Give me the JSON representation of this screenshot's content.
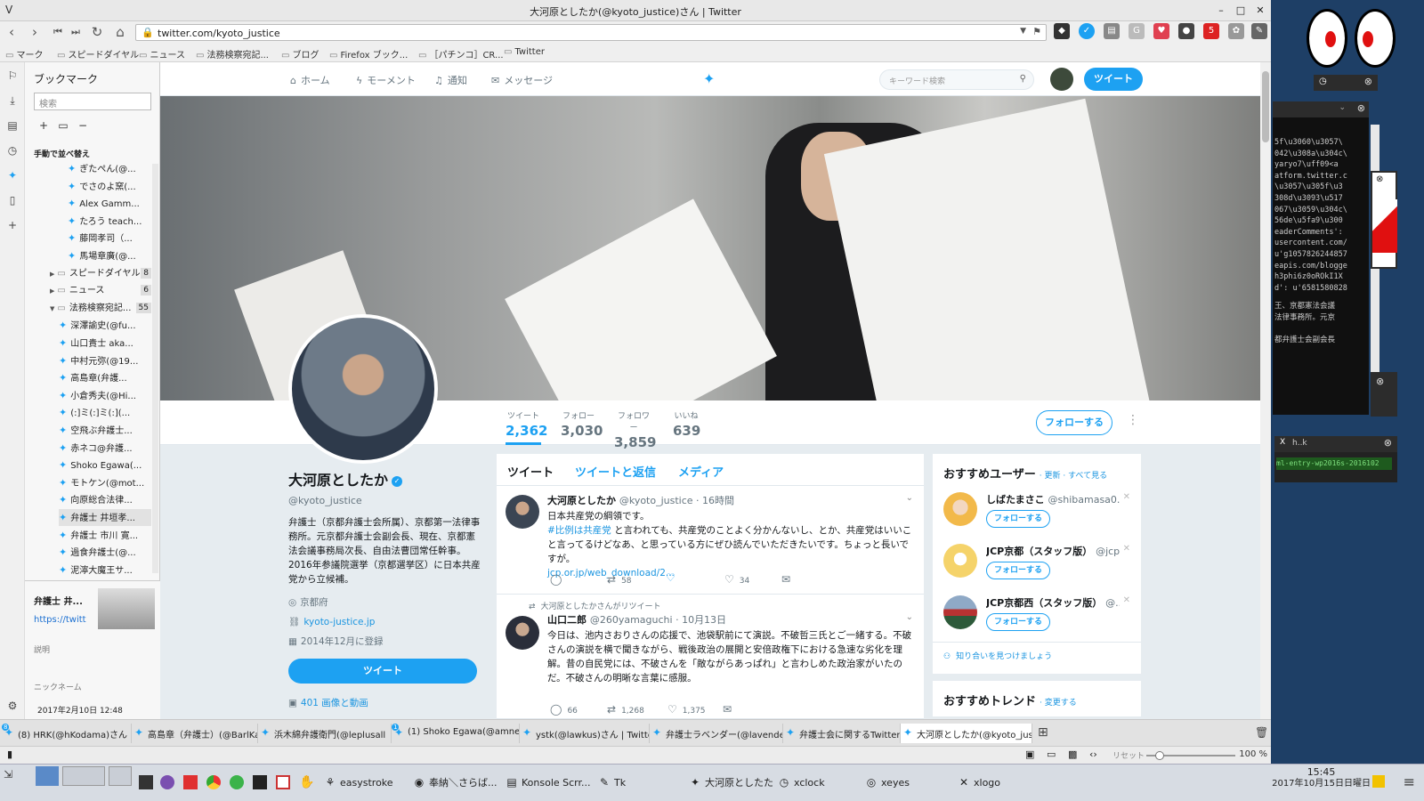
{
  "window": {
    "title": "大河原としたか(@kyoto_justice)さん | Twitter"
  },
  "nav": {
    "url": "twitter.com/kyoto_justice"
  },
  "bookmarks_bar": [
    "マーク",
    "スピードダイヤル",
    "ニュース",
    "法務検察宛記...",
    "ブログ",
    "Firefox ブック...",
    "［パチンコ］CR...",
    "Twitter"
  ],
  "sidebar": {
    "title": "ブックマーク",
    "search_placeholder": "検索",
    "sort_label": "手動で並べ替え",
    "tree": [
      {
        "label": "ぎたぺん(@...",
        "type": "tw",
        "indent": 2
      },
      {
        "label": "でさのよ窯(...",
        "type": "tw",
        "indent": 2
      },
      {
        "label": "Alex Gamm...",
        "type": "tw",
        "indent": 2
      },
      {
        "label": "たろう teach...",
        "type": "tw",
        "indent": 2
      },
      {
        "label": "藤岡孝司（...",
        "type": "tw",
        "indent": 2
      },
      {
        "label": "馬場章廣(@...",
        "type": "tw",
        "indent": 2
      },
      {
        "label": "スピードダイヤル",
        "type": "folder",
        "indent": 1,
        "count": "8",
        "arrow": "▶"
      },
      {
        "label": "ニュース",
        "type": "folder",
        "indent": 1,
        "count": "6",
        "arrow": "▶"
      },
      {
        "label": "法務検察宛記...",
        "type": "folder",
        "indent": 1,
        "count": "55",
        "arrow": "▼"
      },
      {
        "label": "深澤諭史(@fu...",
        "type": "tw",
        "indent": 1.5
      },
      {
        "label": "山口貴士 aka...",
        "type": "tw",
        "indent": 1.5
      },
      {
        "label": "中村元弥(@19...",
        "type": "tw",
        "indent": 1.5
      },
      {
        "label": "高島章(弁護...",
        "type": "tw",
        "indent": 1.5
      },
      {
        "label": "小倉秀夫(@Hi...",
        "type": "tw",
        "indent": 1.5
      },
      {
        "label": "(:]ミ(:]ミ(:](...",
        "type": "tw",
        "indent": 1.5
      },
      {
        "label": "空飛ぶ弁護士...",
        "type": "tw",
        "indent": 1.5
      },
      {
        "label": "赤ネコ@弁護...",
        "type": "tw",
        "indent": 1.5
      },
      {
        "label": "Shoko Egawa(...",
        "type": "tw",
        "indent": 1.5
      },
      {
        "label": "モトケン(@mot...",
        "type": "tw",
        "indent": 1.5
      },
      {
        "label": "向原総合法律...",
        "type": "tw",
        "indent": 1.5
      },
      {
        "label": "弁護士 井垣孝...",
        "type": "tw",
        "indent": 1.5
      },
      {
        "label": "弁護士 市川 寛...",
        "type": "tw",
        "indent": 1.5
      },
      {
        "label": "過食弁護士(@...",
        "type": "tw",
        "indent": 1.5
      },
      {
        "label": "泥濘大魔王サ...",
        "type": "tw",
        "indent": 1.5
      }
    ],
    "detail_title": "弁護士 井...",
    "detail_url": "https://twitt",
    "detail_desc_label": "説明",
    "detail_nick_label": "ニックネーム",
    "detail_date": "2017年2月10日 12:48"
  },
  "twitter_nav": {
    "home": "ホーム",
    "moments": "モーメント",
    "notifications": "通知",
    "messages": "メッセージ",
    "search_placeholder": "キーワード検索",
    "tweet_button": "ツイート"
  },
  "profile": {
    "name": "大河原としたか",
    "handle": "@kyoto_justice",
    "bio": "弁護士（京都弁護士会所属）、京都第一法律事務所。元京都弁護士会副会長、現在、京都憲法会議事務局次長、自由法曹団常任幹事。2016年参議院選挙（京都選挙区）に日本共産党から立候補。",
    "location": "京都府",
    "website": "kyoto-justice.jp",
    "joined": "2014年12月に登録",
    "tweet_button": "ツイート",
    "media_link": "401 画像と動画",
    "follow_button": "フォローする",
    "stats": [
      {
        "label": "ツイート",
        "value": "2,362"
      },
      {
        "label": "フォロー",
        "value": "3,030"
      },
      {
        "label": "フォロワー",
        "value": "3,859"
      },
      {
        "label": "いいね",
        "value": "639"
      }
    ]
  },
  "timeline": {
    "tabs": [
      "ツイート",
      "ツイートと返信",
      "メディア"
    ],
    "tweets": [
      {
        "name": "大河原としたか",
        "meta": "@kyoto_justice · 16時間",
        "line1": "日本共産党の綱領です。",
        "hashtag": "#比例は共産党",
        "line2": " と言われても、共産党のことよく分かんないし、とか、共産党はいいこと言ってるけどなあ、と思っている方にぜひ読んでいただきたいです。ちょっと長いですが。",
        "link": "jcp.or.jp/web_download/2...",
        "retweets": "58",
        "likes": "34"
      },
      {
        "rt_note": "大河原としたかさんがリツイート",
        "name": "山口二郎",
        "meta": "@260yamaguchi · 10月13日",
        "text": "今日は、池内さおりさんの応援で、池袋駅前にて演説。不破哲三氏とご一緒する。不破さんの演説を横で聞きながら、戦後政治の展開と安倍政権下における急速な劣化を理解。昔の自民党には、不破さんを「敵ながらあっぱれ」と言わしめた政治家がいたのだ。不破さんの明晰な言葉に感服。",
        "replies": "66",
        "retweets": "1,268",
        "likes": "1,375"
      }
    ]
  },
  "who_to_follow": {
    "title": "おすすめユーザー",
    "links": "· 更新 · すべて見る",
    "users": [
      {
        "name": "しばたまさこ",
        "handle": "@shibamasa0...",
        "color": "#f2b94a"
      },
      {
        "name": "JCP京都（スタッフ版）",
        "handle": "@jcp...",
        "color": "#f5d36a"
      },
      {
        "name": "JCP京都西（スタッフ版）",
        "handle": "@...",
        "color": "#2d5a3a"
      }
    ],
    "follow_label": "フォローする",
    "find_friends": "知り合いを見つけましょう"
  },
  "trends": {
    "title": "おすすめトレンド",
    "change": "· 変更する"
  },
  "tabs": [
    {
      "label": "(8) HRK(@hKodama)さん |",
      "badge": "8"
    },
    {
      "label": "高島章（弁護士）(@BarlKarl"
    },
    {
      "label": "浜木綿弁護衛門(@leplusall"
    },
    {
      "label": "(1) Shoko Egawa(@amneris",
      "badge": "1"
    },
    {
      "label": "ystk(@lawkus)さん | Twitte"
    },
    {
      "label": "弁護士ラベンダー(@lavende"
    },
    {
      "label": "弁護士会に関するTwitterニ"
    },
    {
      "label": "大河原としたか(@kyoto_jus"
    }
  ],
  "status": {
    "reset": "リセット",
    "zoom": "100 %"
  },
  "taskbar": {
    "items": [
      "easystroke",
      "奉納＼さらば...",
      "Konsole Scrr...",
      "Tk",
      "大河原としたた...",
      "xclock",
      "xeyes",
      "xlogo"
    ],
    "time": "15:45",
    "date": "2017年10月15日日曜日"
  },
  "terminal": {
    "lines": [
      "5f\\u3060\\u3057\\",
      "042\\u308a\\u304c\\",
      "yaryo7\\uff09<a",
      "atform.twitter.c",
      "\\u3057\\u305f\\u3",
      "308d\\u3093\\u517",
      "067\\u3059\\u304c\\",
      "56de\\u5fa9\\u300",
      "eaderComments':",
      "usercontent.com/",
      "u'g1057826244857",
      "eapis.com/blogge",
      "h3phi6z0oROkI1X",
      "d': u'6581580828"
    ],
    "lines2": [
      "王、京都憲法会議",
      "法律事務所。元京",
      "",
      "都弁護士会副会長"
    ],
    "mini_title": "h..k",
    "mini_text": "ml-entry-wp2016s-2016102"
  }
}
